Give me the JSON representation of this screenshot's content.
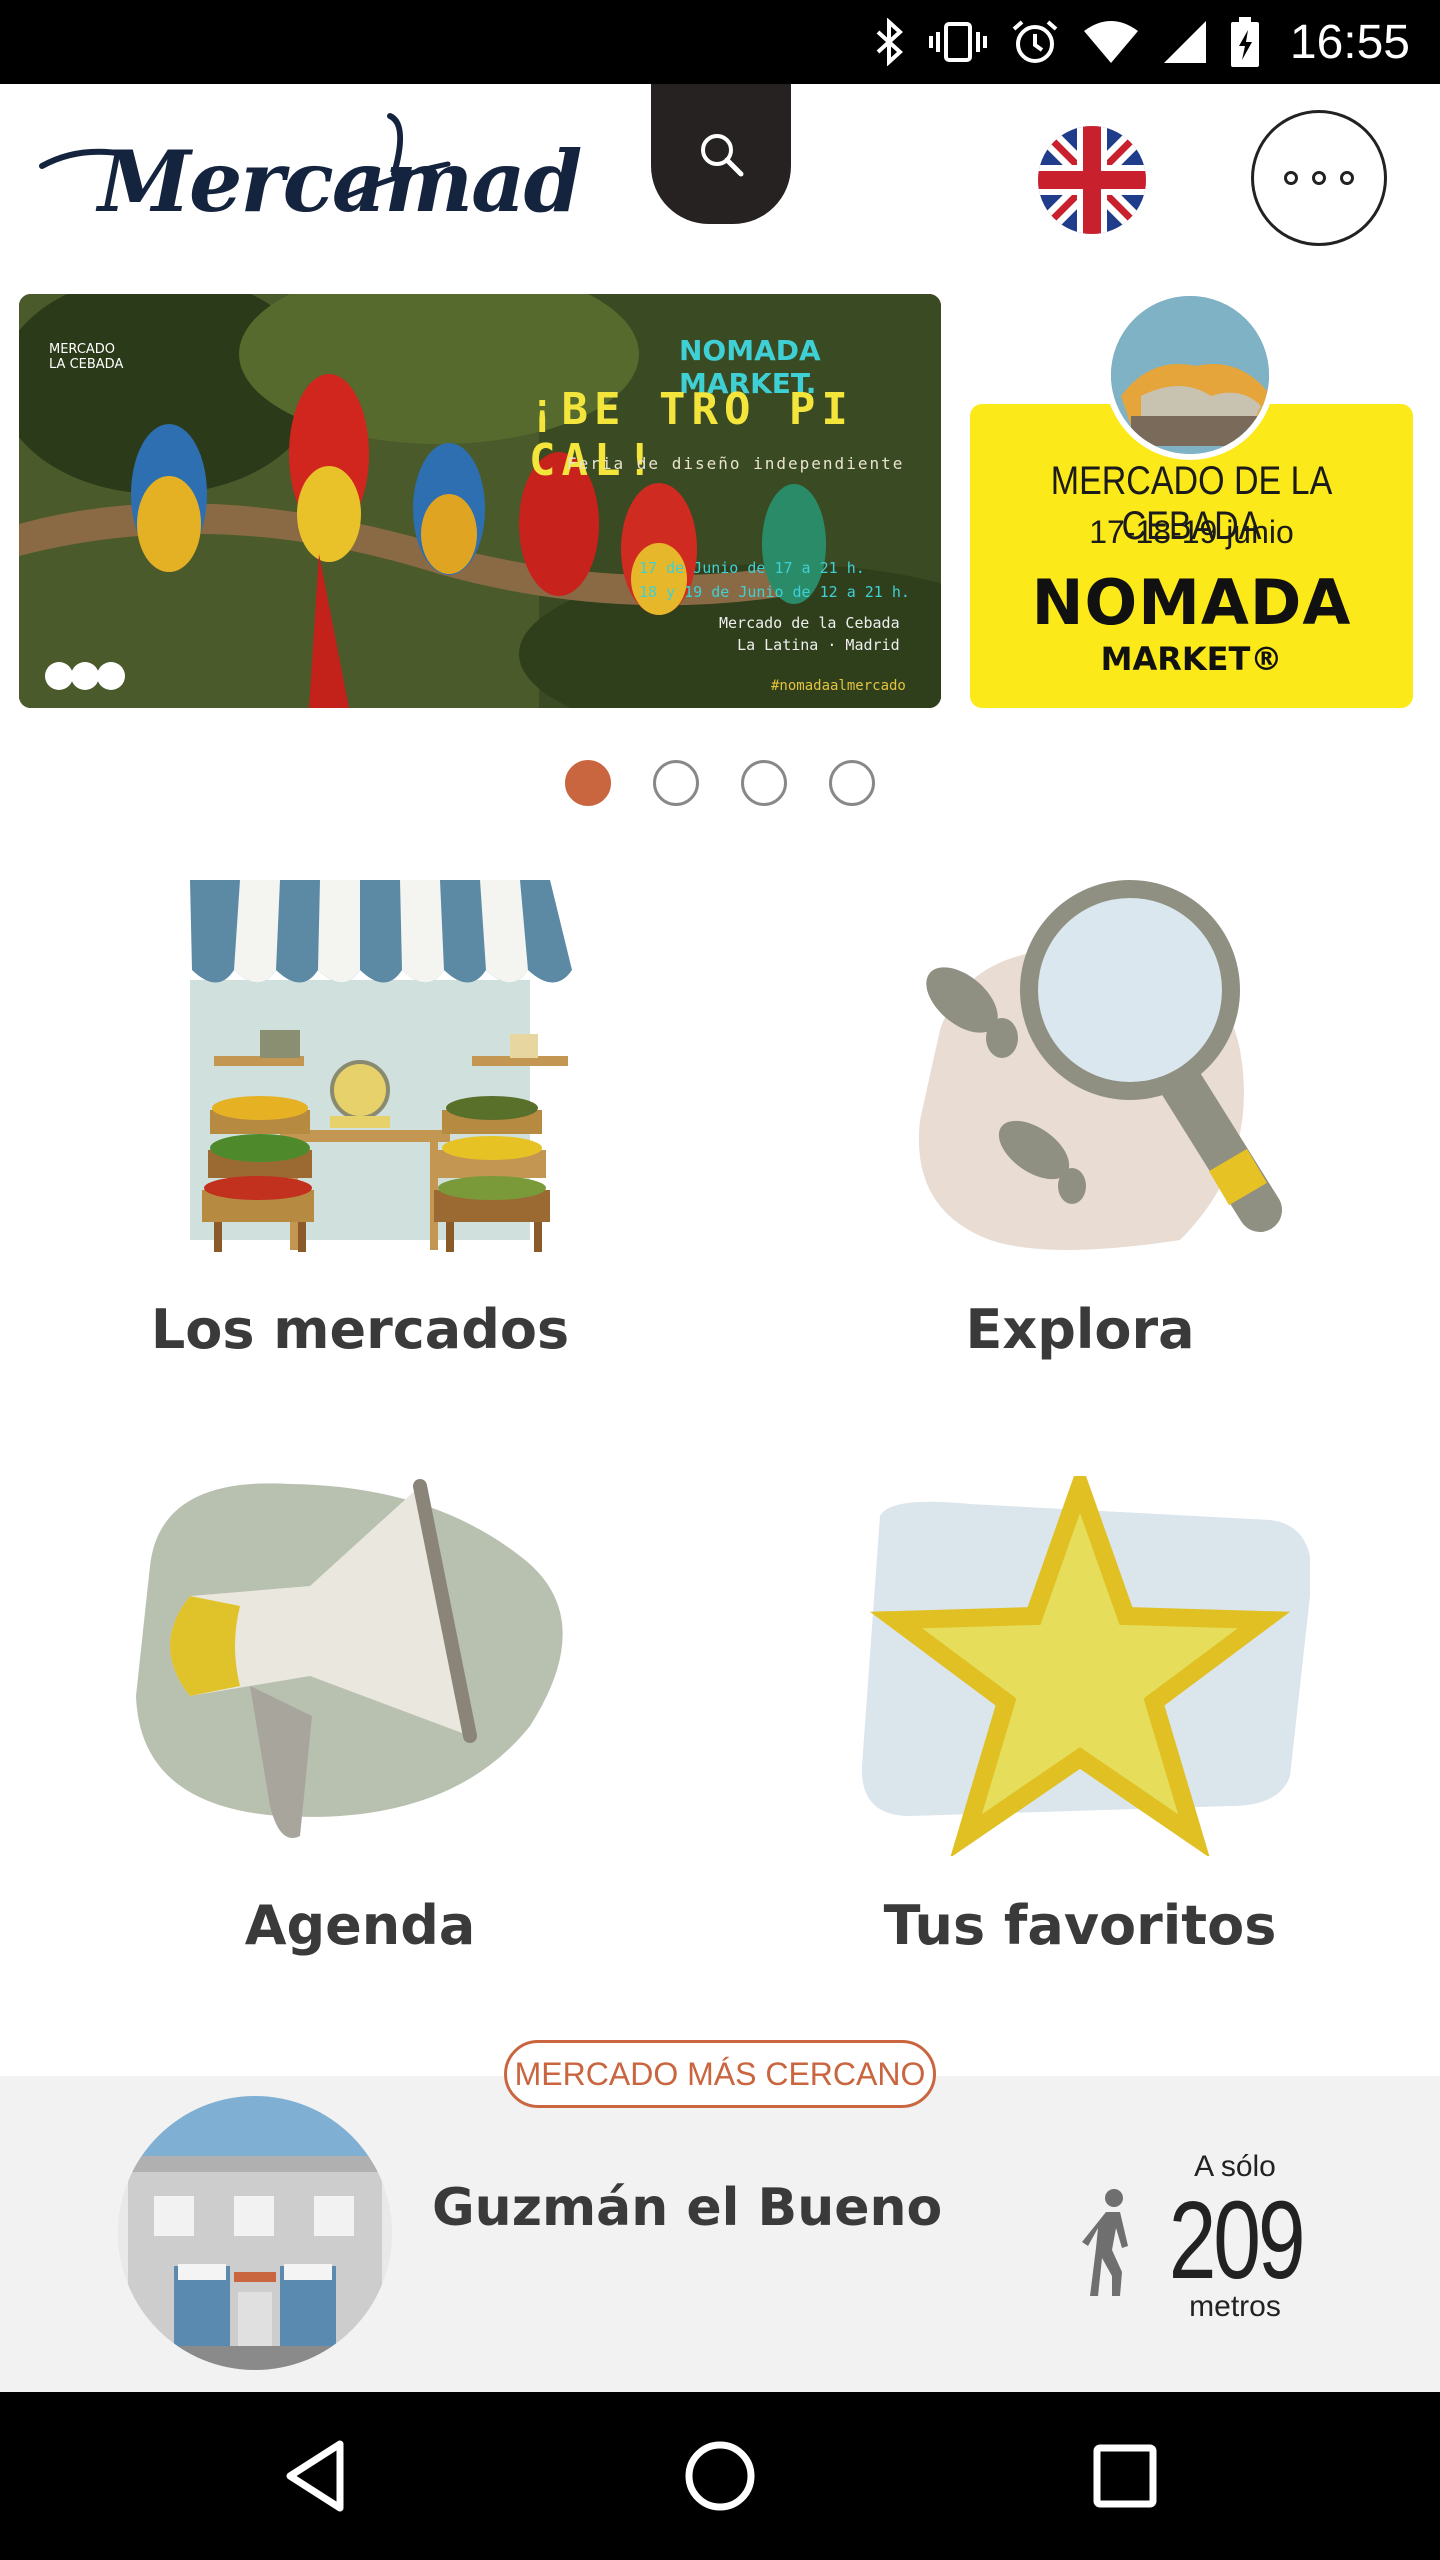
{
  "status_bar": {
    "time": "16:55",
    "icons": [
      "bluetooth-icon",
      "vibrate-icon",
      "alarm-icon",
      "wifi-icon",
      "signal-icon",
      "battery-icon"
    ]
  },
  "header": {
    "logo_text": "Mercamad",
    "search_icon": "search-icon",
    "language_icon": "uk-flag-icon",
    "more_icon": "more-icon"
  },
  "carousel": {
    "slide_1": {
      "brand": "NOMADA MARKET.",
      "headline": "¡BE TRO PI CAL!",
      "subtitle": "Feria de diseño independiente",
      "dates_line_1": "17 de Junio de 17 a 21 h.",
      "dates_line_2": "18 y 19 de Junio de 12 a 21 h.",
      "venue_line_1": "Mercado de la Cebada",
      "venue_line_2": "La Latina · Madrid",
      "hashtag": "#nomadaalmercado",
      "organizer_line_1": "MERCADO",
      "organizer_line_2": "LA CEBADA"
    },
    "slide_2": {
      "title": "MERCADO DE LA CEBADA",
      "dates": "17-18-19 junio",
      "brand": "NOMADA",
      "brand_sub": "MARKET®"
    },
    "pages": 4,
    "active_page": 1
  },
  "menu": [
    {
      "label": "Los mercados",
      "icon": "market-stall-icon"
    },
    {
      "label": "Explora",
      "icon": "magnifier-icon"
    },
    {
      "label": "Agenda",
      "icon": "megaphone-icon"
    },
    {
      "label": "Tus favoritos",
      "icon": "star-icon"
    }
  ],
  "nearest": {
    "tag": "MERCADO MÁS CERCANO",
    "market_name": "Guzmán el Bueno",
    "distance_prefix": "A sólo",
    "distance_value": "209",
    "distance_unit": "metros"
  },
  "nav_bar": {
    "buttons": [
      "back-icon",
      "home-icon",
      "recents-icon"
    ]
  },
  "colors": {
    "accent": "#c9653f",
    "logo": "#15243e",
    "text": "#3a3a3a",
    "search_tab": "#262222"
  }
}
